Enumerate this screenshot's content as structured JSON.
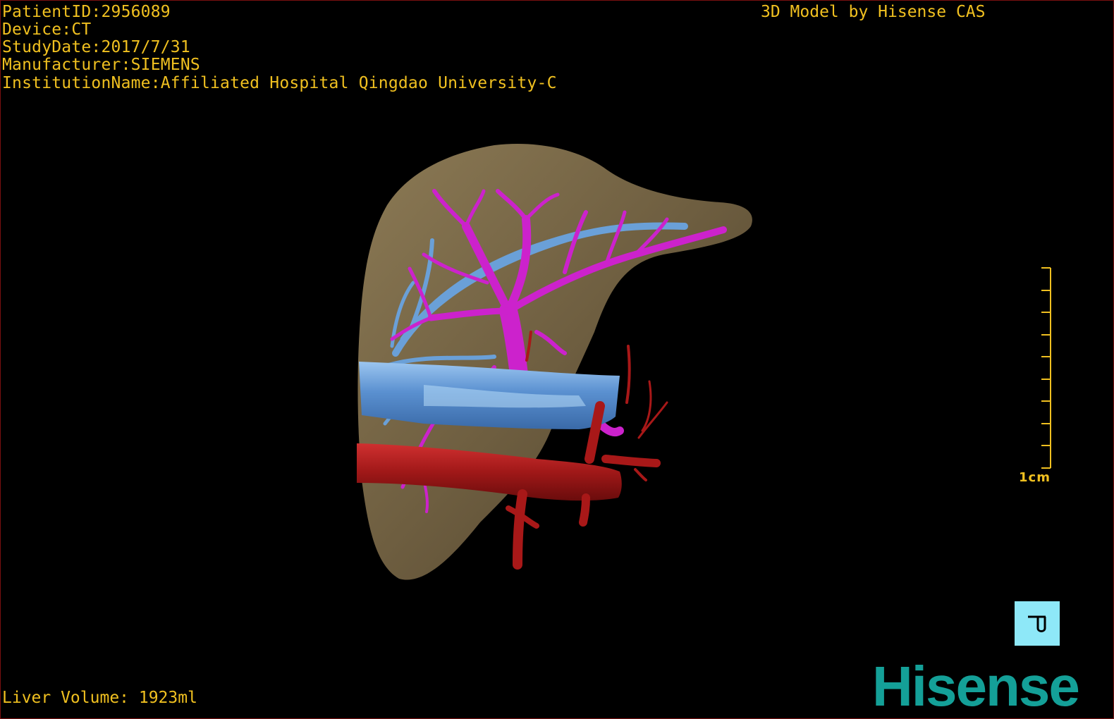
{
  "overlay": {
    "patient_id": "PatientID:2956089",
    "device": "Device:CT",
    "study_date": "StudyDate:2017/7/31",
    "manufacturer": "Manufacturer:SIEMENS",
    "institution": "InstitutionName:Affiliated Hospital Qingdao University-C",
    "credit": "3D Model by Hisense CAS",
    "liver_volume": "Liver Volume: 1923ml"
  },
  "scale_bar": {
    "label": "1cm"
  },
  "tool_button": {
    "icon": "rotate-view-icon"
  },
  "brand": {
    "logo_text": "Hisense"
  },
  "colors": {
    "text": "#f0c020",
    "liver": "#7a6a48",
    "portal_vein": "#cc22cc",
    "hepatic_vein": "#6aa0d8",
    "artery": "#a81818",
    "brand": "#14a098",
    "tool_button_bg": "#8ee8f8"
  }
}
